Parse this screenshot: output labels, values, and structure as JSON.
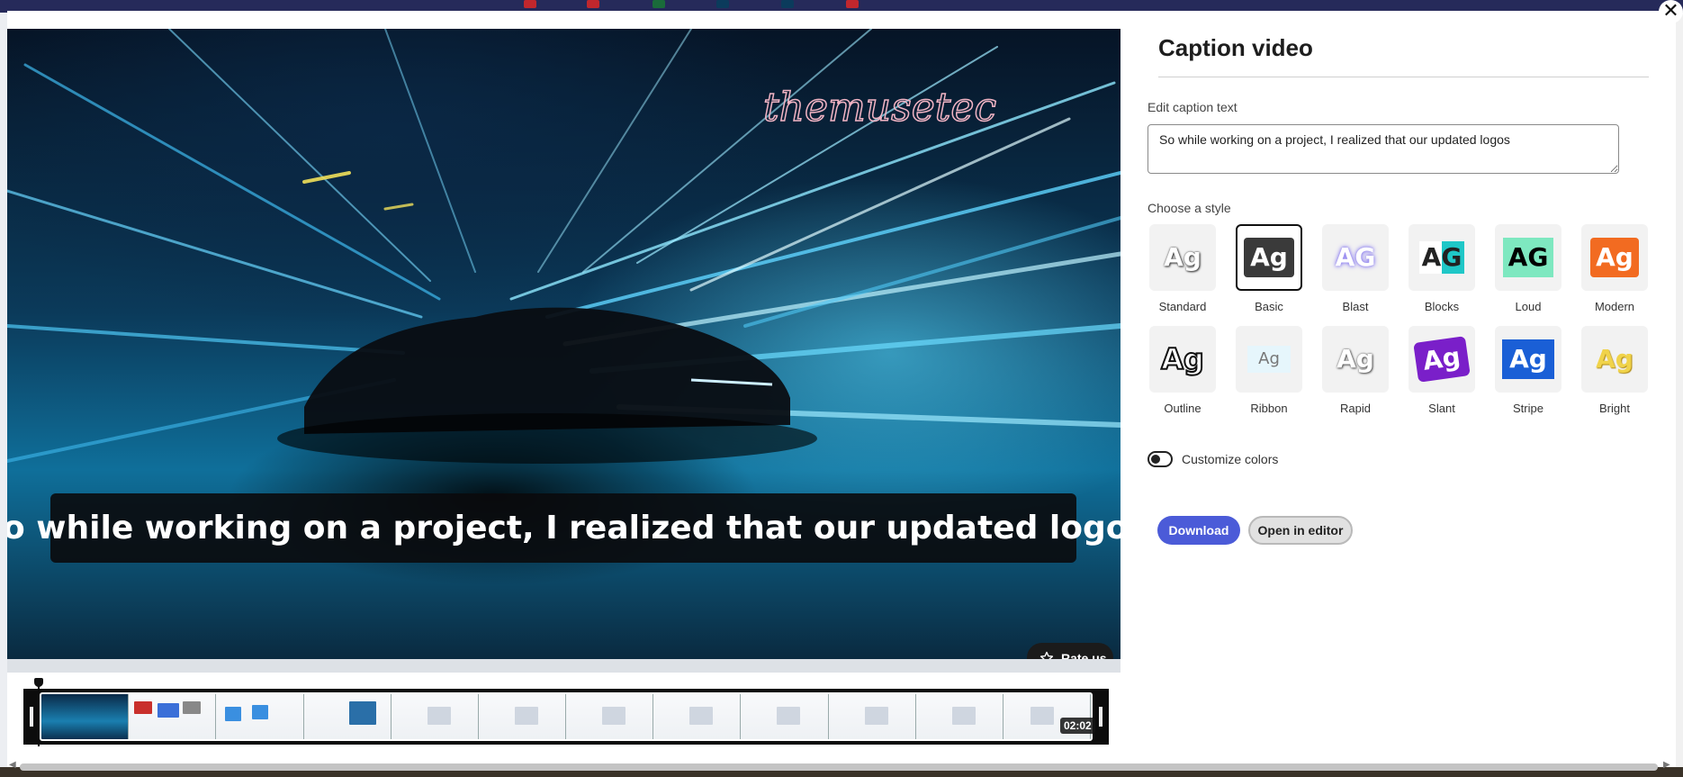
{
  "panel": {
    "title": "Caption video",
    "edit_label": "Edit caption text",
    "caption_value": "So while working on a project, I realized that our updated logos",
    "style_label": "Choose a style",
    "styles": [
      {
        "name": "Standard"
      },
      {
        "name": "Basic",
        "selected": true
      },
      {
        "name": "Blast"
      },
      {
        "name": "Blocks"
      },
      {
        "name": "Loud"
      },
      {
        "name": "Modern"
      },
      {
        "name": "Outline"
      },
      {
        "name": "Ribbon"
      },
      {
        "name": "Rapid"
      },
      {
        "name": "Slant"
      },
      {
        "name": "Stripe"
      },
      {
        "name": "Bright"
      }
    ],
    "style_glyph": "Ag",
    "customize_label": "Customize colors",
    "customize_on": false,
    "download_label": "Download",
    "editor_label": "Open in editor"
  },
  "video": {
    "caption_overlay": "So while working on a project, I realized that our updated logos",
    "watermark": "themusetech",
    "rate_label": "Rate us"
  },
  "timeline": {
    "duration": "02:02"
  },
  "colors": {
    "accent": "#4b5bd8",
    "loud_bg": "#7ee8c0",
    "modern_bg": "#f26b21",
    "slant_bg": "#7a1fc9",
    "stripe_bg": "#1a5fd6",
    "bright_text": "#f0d34a"
  }
}
